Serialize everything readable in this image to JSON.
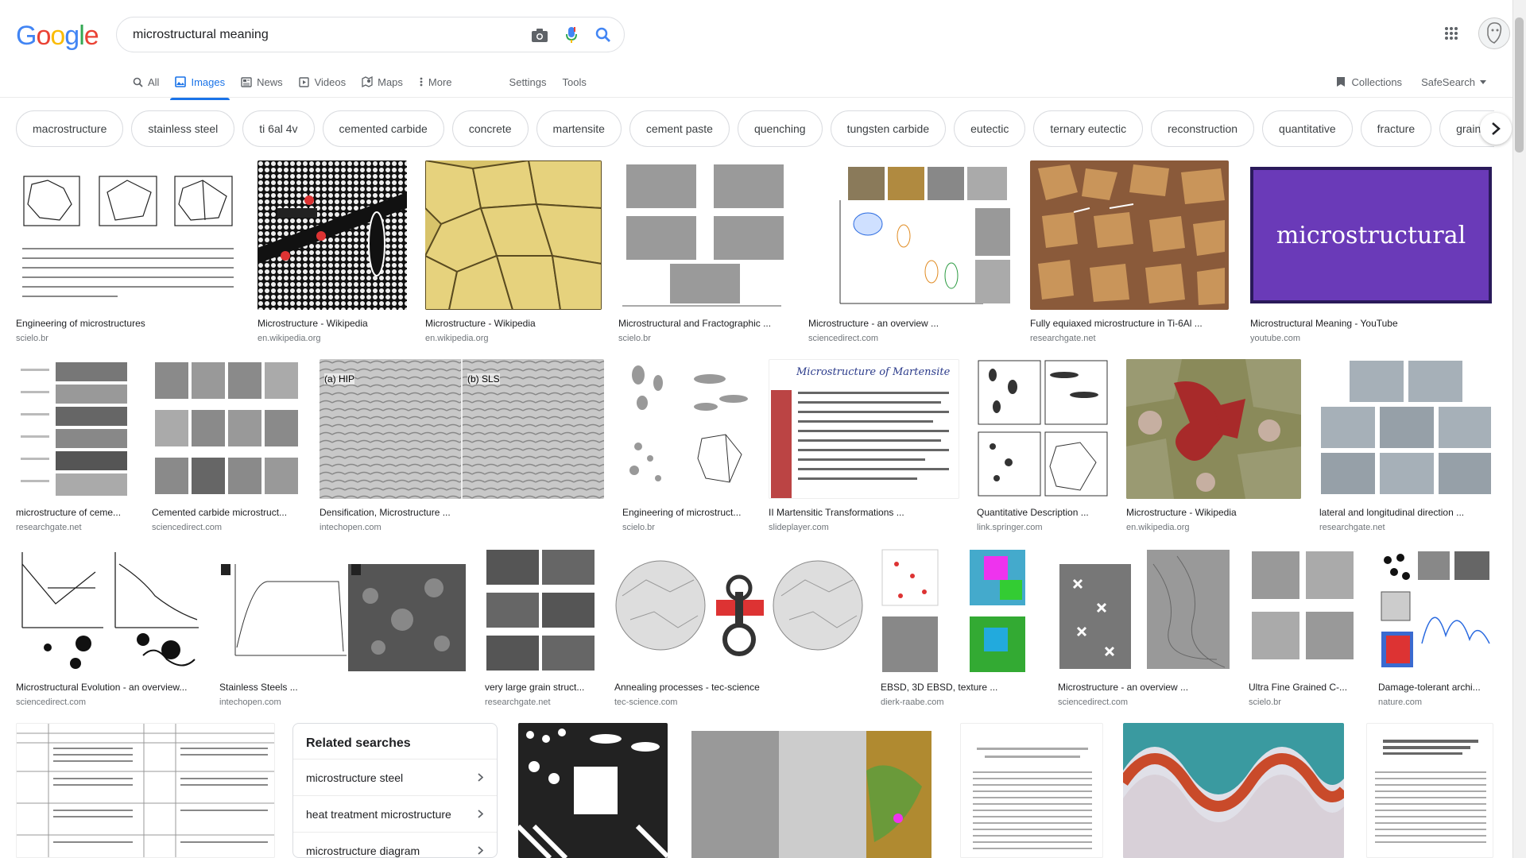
{
  "logo": {
    "letters": [
      {
        "ch": "G",
        "color": "#4285F4"
      },
      {
        "ch": "o",
        "color": "#EA4335"
      },
      {
        "ch": "o",
        "color": "#FBBC05"
      },
      {
        "ch": "g",
        "color": "#4285F4"
      },
      {
        "ch": "l",
        "color": "#34A853"
      },
      {
        "ch": "e",
        "color": "#EA4335"
      }
    ]
  },
  "search": {
    "value": "microstructural meaning"
  },
  "tabs": [
    "All",
    "Images",
    "News",
    "Videos",
    "Maps",
    "More"
  ],
  "tools": [
    "Settings",
    "Tools"
  ],
  "right_tools": [
    "Collections",
    "SafeSearch"
  ],
  "chips": [
    "macrostructure",
    "stainless steel",
    "ti 6al 4v",
    "cemented carbide",
    "concrete",
    "martensite",
    "cement paste",
    "quenching",
    "tungsten carbide",
    "eutectic",
    "ternary eutectic",
    "reconstruction",
    "quantitative",
    "fracture",
    "grain bou"
  ],
  "row1": [
    {
      "caption": "Engineering of microstructures",
      "source": "scielo.br"
    },
    {
      "caption": "Microstructure - Wikipedia",
      "source": "en.wikipedia.org"
    },
    {
      "caption": "Microstructure - Wikipedia",
      "source": "en.wikipedia.org"
    },
    {
      "caption": "Microstructural and Fractographic ...",
      "source": "scielo.br"
    },
    {
      "caption": "Microstructure - an overview ...",
      "source": "sciencedirect.com"
    },
    {
      "caption": "Fully equiaxed microstructure in Ti-6Al ...",
      "source": "researchgate.net"
    },
    {
      "caption": "Microstructural Meaning - YouTube",
      "source": "youtube.com"
    }
  ],
  "row2": [
    {
      "caption": "microstructure of ceme...",
      "source": "researchgate.net"
    },
    {
      "caption": "Cemented carbide microstruct...",
      "source": "sciencedirect.com"
    },
    {
      "caption": "Densification, Microstructure ...",
      "source": "intechopen.com"
    },
    {
      "caption": "Engineering of microstruct...",
      "source": "scielo.br"
    },
    {
      "caption": "II Martensitic Transformations ...",
      "source": "slideplayer.com"
    },
    {
      "caption": "Quantitative Description ...",
      "source": "link.springer.com"
    },
    {
      "caption": "Microstructure - Wikipedia",
      "source": "en.wikipedia.org"
    },
    {
      "caption": "lateral and longitudinal direction ...",
      "source": "researchgate.net"
    }
  ],
  "row3": [
    {
      "caption": "Microstructural Evolution - an overview...",
      "source": "sciencedirect.com"
    },
    {
      "caption": "Stainless Steels ...",
      "source": "intechopen.com"
    },
    {
      "caption": "very large grain struct...",
      "source": "researchgate.net"
    },
    {
      "caption": "Annealing processes - tec-science",
      "source": "tec-science.com"
    },
    {
      "caption": "EBSD, 3D EBSD, texture ...",
      "source": "dierk-raabe.com"
    },
    {
      "caption": "Microstructure - an overview ...",
      "source": "sciencedirect.com"
    },
    {
      "caption": "Ultra Fine Grained C-...",
      "source": "scielo.br"
    },
    {
      "caption": "Damage-tolerant archi...",
      "source": "nature.com"
    }
  ],
  "thumb_text": {
    "youtube": "microstructural",
    "martensite": "Microstructure of Martensite",
    "hip": "(a) HIP",
    "sls": "(b) SLS"
  },
  "related": {
    "title": "Related searches",
    "items": [
      "microstructure steel",
      "heat treatment microstructure",
      "microstructure diagram"
    ]
  }
}
